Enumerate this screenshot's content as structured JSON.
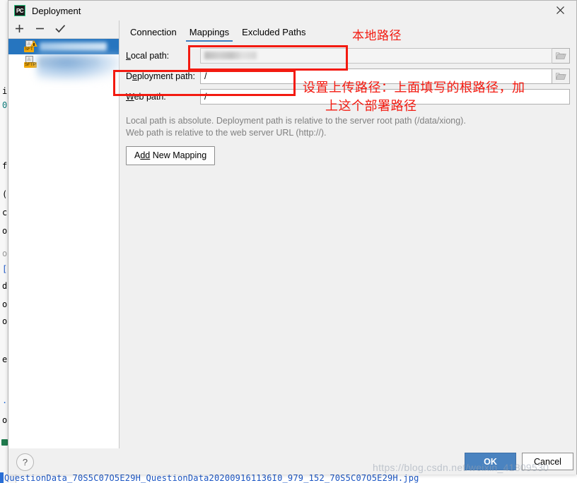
{
  "window": {
    "title": "Deployment",
    "app_icon": "pycharm-icon",
    "app_icon_text": "PC",
    "close_icon": "close-icon"
  },
  "left_pane": {
    "toolbar": [
      {
        "name": "add-server-button",
        "icon": "plus-icon",
        "glyph": "+"
      },
      {
        "name": "remove-server-button",
        "icon": "minus-icon",
        "glyph": "−"
      },
      {
        "name": "set-default-server-button",
        "icon": "check-icon",
        "glyph": "✓"
      }
    ],
    "servers": [
      {
        "name": "server-item-selected",
        "protocol_tag": "SFT",
        "label": "",
        "selected": true,
        "warning": true
      },
      {
        "name": "server-item",
        "protocol_tag": "SFTP",
        "label": "",
        "selected": false,
        "warning": false
      }
    ]
  },
  "tabs": [
    {
      "name": "tab-connection",
      "label": "Connection",
      "active": false
    },
    {
      "name": "tab-mappings",
      "label": "Mappings",
      "active": true
    },
    {
      "name": "tab-excluded-paths",
      "label": "Excluded Paths",
      "active": false
    }
  ],
  "form": {
    "local_path": {
      "label_pre": "",
      "label_mn": "L",
      "label_post": "ocal path:",
      "value": "",
      "value_masked": true,
      "browse_icon": "folder-icon"
    },
    "deployment_path": {
      "label_pre": "D",
      "label_mn": "e",
      "label_post": "ployment path:",
      "value": "/",
      "browse_icon": "folder-icon"
    },
    "web_path": {
      "label_pre": "",
      "label_mn": "W",
      "label_post": "eb path:",
      "value": "/"
    },
    "hint_line_1": "Local path is absolute. Deployment path is relative to the server root path (/data/xiong).",
    "hint_line_2": "Web path is relative to the web server URL (http://).",
    "add_new_mapping": {
      "pre": "A",
      "mn": "dd",
      "post": " New Mapping"
    }
  },
  "footer": {
    "help_label": "?",
    "help_icon": "question-mark-icon",
    "ok_label": "OK",
    "cancel_label": "Cancel"
  },
  "annotations": {
    "accent_color": "#f31a10",
    "local_path_label": "本地路径",
    "deployment_line_1": "设置上传路径：上面填写的根路径，加",
    "deployment_line_2": "上这个部署路径"
  },
  "watermark": "https://blog.csdn.net/weixin_41809530",
  "background_editor": {
    "gutter_chars": [
      "i",
      "0",
      "f",
      "(",
      "c",
      "o",
      "o",
      "[",
      "d",
      "o",
      "o",
      "e",
      ".",
      "o"
    ],
    "bottom_line": "QuestionData_70S5C07O5E29H_QuestionData202009161136I0_979_152_70S5C07O5E29H.jpg"
  },
  "colors": {
    "dialog_bg": "#f0f0f0",
    "selection_blue": "#2675bf",
    "tab_underline": "#3d7ec0",
    "ok_button": "#4a83c0",
    "annotation_red": "#f31a10",
    "hint_gray": "#808080",
    "code_blue": "#1a55c4"
  }
}
